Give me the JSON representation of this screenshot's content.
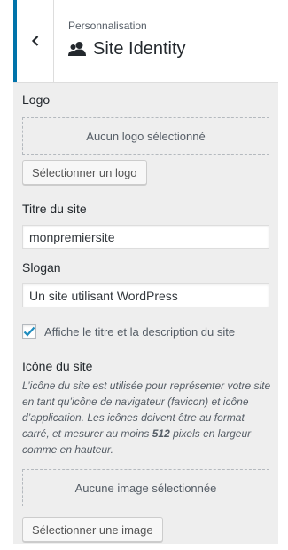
{
  "header": {
    "breadcrumb": "Personnalisation",
    "title": "Site Identity",
    "back_icon": "chevron-left-icon",
    "title_icon": "users-icon"
  },
  "logo": {
    "label": "Logo",
    "placeholder": "Aucun logo sélectionné",
    "button_label": "Sélectionner un logo"
  },
  "site_title": {
    "label": "Titre du site",
    "value": "monpremiersite"
  },
  "tagline": {
    "label": "Slogan",
    "value": "Un site utilisant WordPress"
  },
  "display_header_text": {
    "checked": true,
    "label": "Affiche le titre et la description du site"
  },
  "site_icon": {
    "label": "Icône du site",
    "description_before": "L’icône du site est utilisée pour représenter votre site en tant qu’icône de navigateur (favicon) et icône d’application. Les icônes doivent être au format carré, et mesurer au moins ",
    "description_strong": "512",
    "description_after": " pixels en largeur comme en hauteur.",
    "placeholder": "Aucune image sélectionnée",
    "button_label": "Sélectionner une image"
  },
  "colors": {
    "accent": "#0073aa",
    "panel_background": "#eeeeee"
  }
}
